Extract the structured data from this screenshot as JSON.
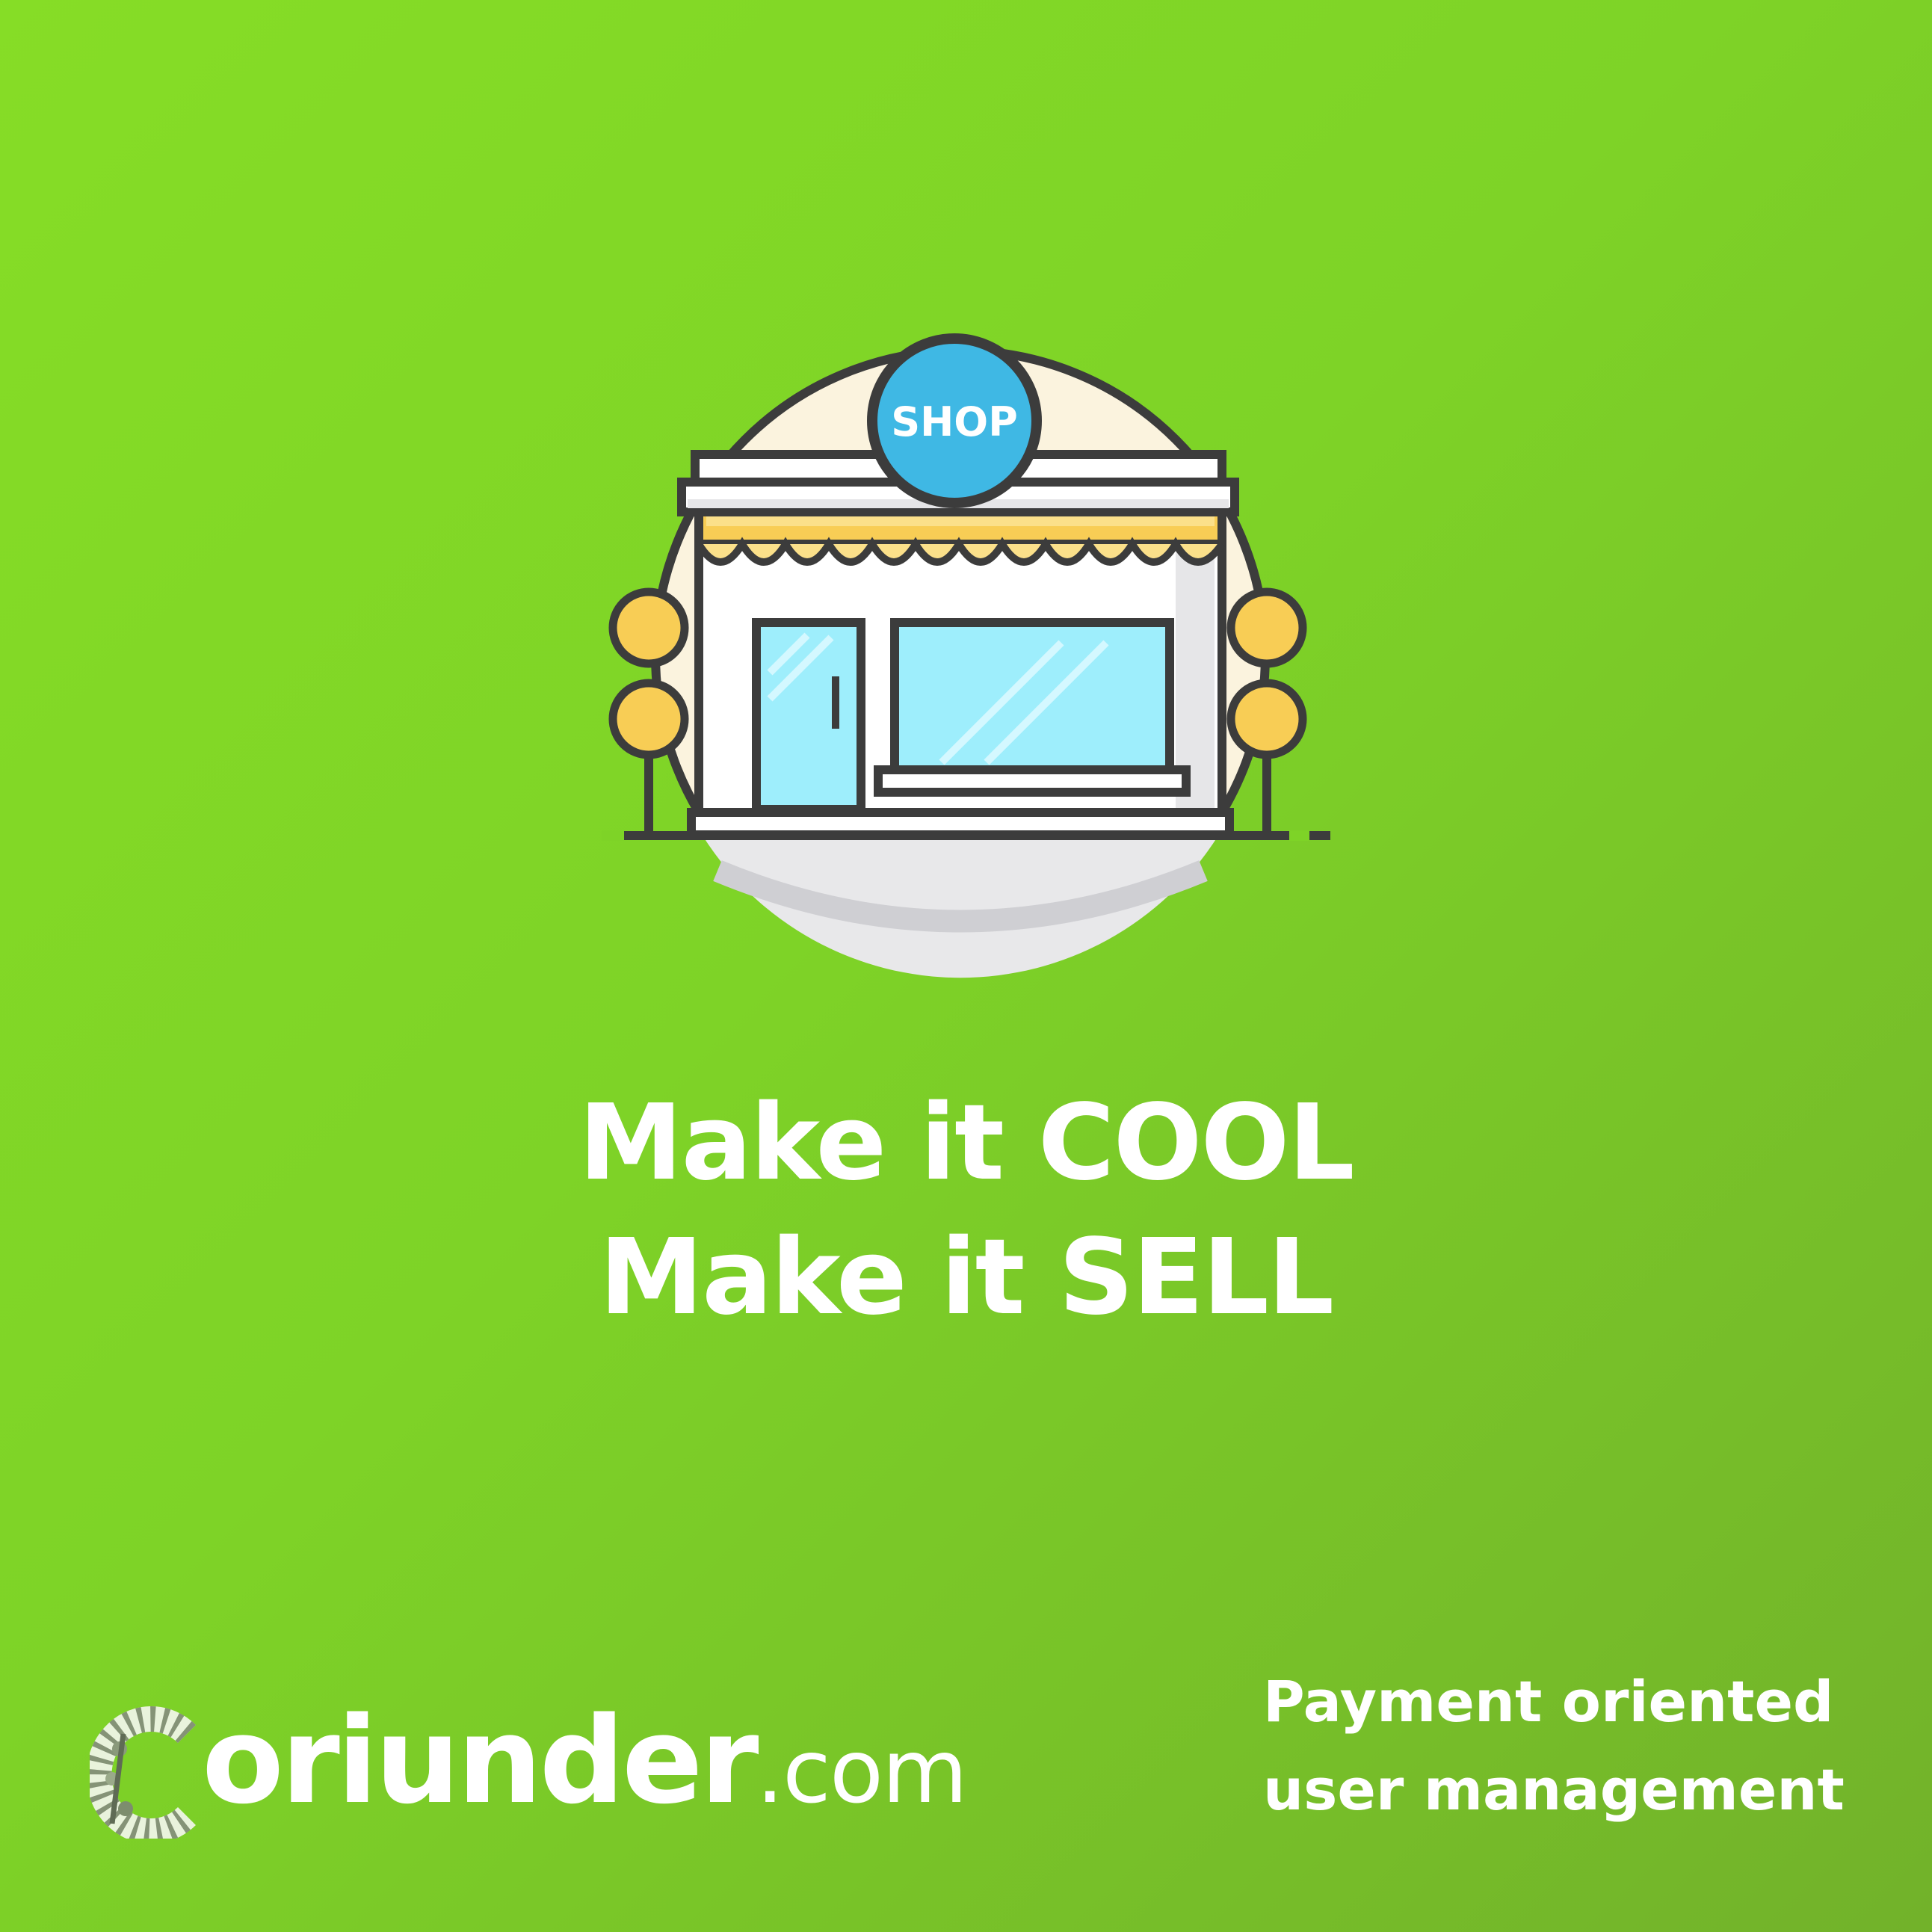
{
  "colors": {
    "background_start": "#86dd26",
    "background_end": "#72b22a",
    "text": "#ffffff",
    "outline": "#3c3c3c",
    "awning_yellow": "#f7d35d",
    "sign_blue": "#3fb8e4",
    "glass": "#9eeefc"
  },
  "illustration": {
    "name": "shop-icon",
    "sign_text": "SHOP"
  },
  "headline": {
    "line1": "Make it COOL",
    "line2": "Make it SELL"
  },
  "logo": {
    "icon": "coriander-leaf-c-icon",
    "name": "oriunder",
    "suffix": ".com"
  },
  "tagline": {
    "line1": "Payment oriented",
    "line2": "user management"
  }
}
